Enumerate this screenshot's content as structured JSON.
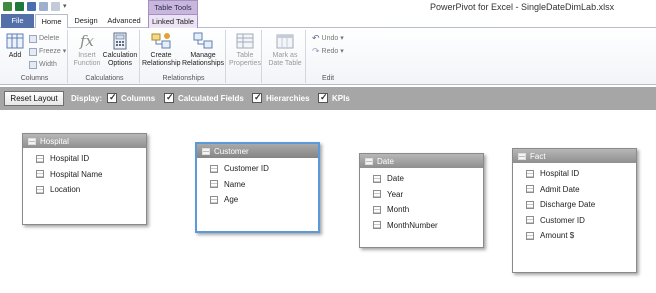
{
  "window": {
    "title": "PowerPivot for Excel - SingleDateDimLab.xlsx",
    "context_tab_group": "Table Tools"
  },
  "tabs": [
    {
      "label": "File"
    },
    {
      "label": "Home"
    },
    {
      "label": "Design"
    },
    {
      "label": "Advanced"
    },
    {
      "label": "Linked Table"
    }
  ],
  "ribbon": {
    "columns_group": {
      "label": "Columns",
      "add": "Add",
      "delete": "Delete",
      "freeze": "Freeze",
      "width": "Width"
    },
    "calculations_group": {
      "label": "Calculations",
      "insert_function": "Insert Function",
      "calculation_options": "Calculation Options"
    },
    "relationships_group": {
      "label": "Relationships",
      "create": "Create Relationship",
      "manage": "Manage Relationships"
    },
    "table_properties": "Table Properties",
    "mark_as_date_table": "Mark as Date Table",
    "edit_group": {
      "label": "Edit",
      "undo": "Undo",
      "redo": "Redo"
    }
  },
  "display_bar": {
    "reset_layout": "Reset Layout",
    "display_label": "Display:",
    "options": [
      {
        "label": "Columns",
        "checked": true
      },
      {
        "label": "Calculated Fields",
        "checked": true
      },
      {
        "label": "Hierarchies",
        "checked": true
      },
      {
        "label": "KPIs",
        "checked": true
      }
    ]
  },
  "tables": [
    {
      "name": "Hospital",
      "selected": false,
      "columns": [
        "Hospital ID",
        "Hospital Name",
        "Location"
      ]
    },
    {
      "name": "Customer",
      "selected": true,
      "columns": [
        "Customer ID",
        "Name",
        "Age"
      ]
    },
    {
      "name": "Date",
      "selected": false,
      "columns": [
        "Date",
        "Year",
        "Month",
        "MonthNumber"
      ]
    },
    {
      "name": "Fact",
      "selected": false,
      "columns": [
        "Hospital ID",
        "Admit Date",
        "Discharge Date",
        "Customer ID",
        "Amount $"
      ]
    }
  ],
  "colors": {
    "accent": "#5470a8",
    "context_tab": "#c9b6dd",
    "display_bar": "#a6a6a6",
    "selected_table": "#5a9ad8"
  }
}
